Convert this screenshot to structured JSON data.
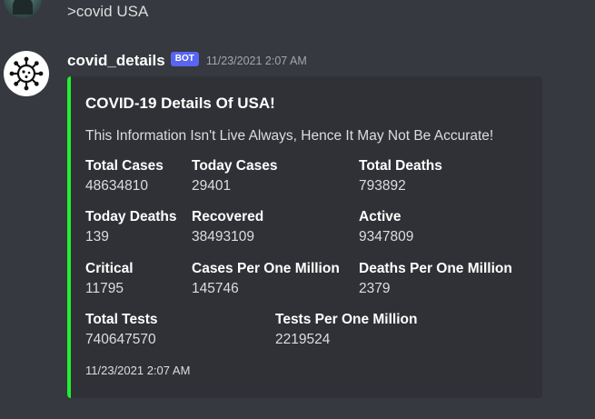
{
  "previous_message": {
    "text": ">covid USA"
  },
  "message": {
    "username": "covid_details",
    "bot_tag": "BOT",
    "timestamp": "11/23/2021 2:07 AM",
    "avatar_icon": "virus-icon",
    "embed": {
      "accent_color": "#1ef02e",
      "title": "COVID-19 Details Of USA!",
      "description": "This Information Isn't Live Always, Hence It May Not Be Accurate!",
      "fields": [
        {
          "name": "Total Cases",
          "value": "48634810"
        },
        {
          "name": "Today Cases",
          "value": "29401"
        },
        {
          "name": "Total Deaths",
          "value": "793892"
        },
        {
          "name": "Today Deaths",
          "value": "139"
        },
        {
          "name": "Recovered",
          "value": "38493109"
        },
        {
          "name": "Active",
          "value": "9347809"
        },
        {
          "name": "Critical",
          "value": "11795"
        },
        {
          "name": "Cases Per One Million",
          "value": "145746"
        },
        {
          "name": "Deaths Per One Million",
          "value": "2379"
        },
        {
          "name": "Total Tests",
          "value": "740647570"
        },
        {
          "name": "Tests Per One Million",
          "value": "2219524"
        }
      ],
      "footer": "11/23/2021 2:07 AM"
    }
  }
}
